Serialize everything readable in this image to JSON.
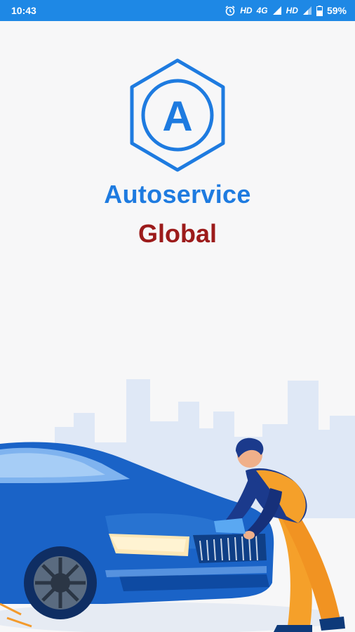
{
  "status_bar": {
    "time": "10:43",
    "network_1": "HD",
    "network_type": "4G",
    "network_2": "HD",
    "battery": "59%"
  },
  "brand": {
    "logo_letter": "A",
    "title": "Autoservice",
    "subtitle": "Global"
  },
  "colors": {
    "accent": "#1e88e5",
    "title": "#1e7be0",
    "subtitle": "#9c1b1b",
    "mechanic_overalls": "#f5a02a",
    "car": "#1a63c7"
  },
  "icons": [
    "alarm-icon",
    "signal-icon",
    "battery-icon"
  ]
}
